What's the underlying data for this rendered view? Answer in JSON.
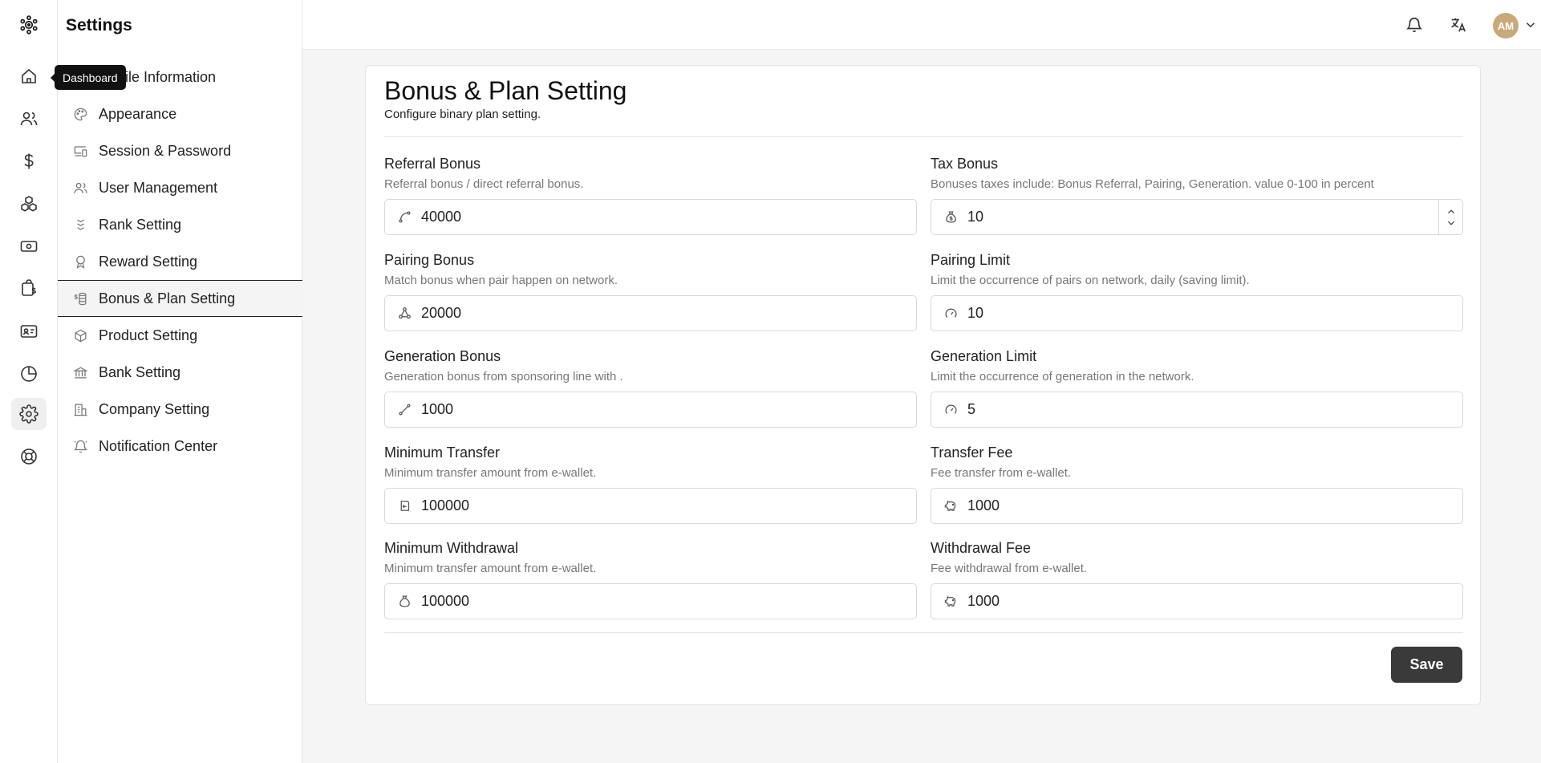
{
  "rail": {
    "tooltip": "Dashboard"
  },
  "sidebar": {
    "title": "Settings",
    "items": [
      {
        "label": "Profile Information",
        "icon": "user-id-icon"
      },
      {
        "label": "Appearance",
        "icon": "palette-icon"
      },
      {
        "label": "Session & Password",
        "icon": "devices-icon"
      },
      {
        "label": "User Management",
        "icon": "users-icon"
      },
      {
        "label": "Rank Setting",
        "icon": "rank-chevrons-icon"
      },
      {
        "label": "Reward Setting",
        "icon": "award-icon"
      },
      {
        "label": "Bonus & Plan Setting",
        "icon": "coins-icon"
      },
      {
        "label": "Product Setting",
        "icon": "box-icon"
      },
      {
        "label": "Bank Setting",
        "icon": "bank-icon"
      },
      {
        "label": "Company Setting",
        "icon": "building-icon"
      },
      {
        "label": "Notification Center",
        "icon": "bell-icon"
      }
    ],
    "active_index": 6
  },
  "header": {
    "avatar_initials": "AM"
  },
  "card": {
    "title": "Bonus & Plan Setting",
    "subtitle": "Configure binary plan setting.",
    "fields": {
      "referral_bonus": {
        "label": "Referral Bonus",
        "help": "Referral bonus / direct referral bonus.",
        "value": "40000",
        "icon": "route-icon"
      },
      "tax_bonus": {
        "label": "Tax Bonus",
        "help": "Bonuses taxes include: Bonus Referral, Pairing, Generation. value 0-100 in percent",
        "value": "10",
        "icon": "money-bag-icon"
      },
      "pairing_bonus": {
        "label": "Pairing Bonus",
        "help": "Match bonus when pair happen on network.",
        "value": "20000",
        "icon": "network-icon"
      },
      "pairing_limit": {
        "label": "Pairing Limit",
        "help": "Limit the occurrence of pairs on network, daily (saving limit).",
        "value": "10",
        "icon": "gauge-icon"
      },
      "generation_bonus": {
        "label": "Generation Bonus",
        "help": "Generation bonus from sponsoring line with .",
        "value": "1000",
        "icon": "line-icon"
      },
      "generation_limit": {
        "label": "Generation Limit",
        "help": "Limit the occurrence of generation in the network.",
        "value": "5",
        "icon": "gauge-icon"
      },
      "minimum_transfer": {
        "label": "Minimum Transfer",
        "help": "Minimum transfer amount from e-wallet.",
        "value": "100000",
        "icon": "transfer-icon"
      },
      "transfer_fee": {
        "label": "Transfer Fee",
        "help": "Fee transfer from e-wallet.",
        "value": "1000",
        "icon": "piggy-bank-icon"
      },
      "minimum_withdrawal": {
        "label": "Minimum Withdrawal",
        "help": "Minimum transfer amount from e-wallet.",
        "value": "100000",
        "icon": "pouch-icon"
      },
      "withdrawal_fee": {
        "label": "Withdrawal Fee",
        "help": "Fee withdrawal from e-wallet.",
        "value": "1000",
        "icon": "piggy-bank-icon"
      }
    },
    "save_label": "Save"
  }
}
